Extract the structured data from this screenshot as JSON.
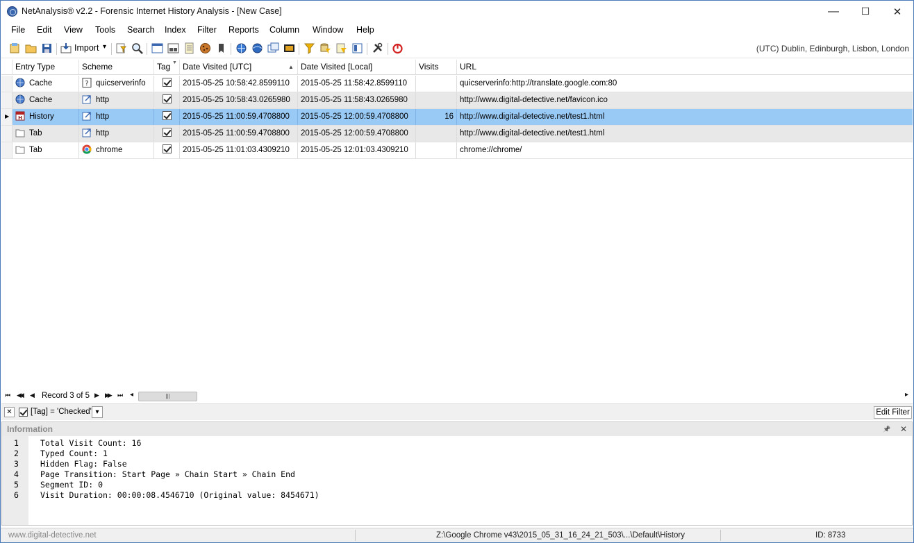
{
  "window": {
    "title": "NetAnalysis® v2.2 - Forensic Internet History Analysis - [New Case]",
    "minimize_glyph": "—",
    "maximize_glyph": "☐",
    "close_glyph": "✕"
  },
  "menu": [
    "File",
    "Edit",
    "View",
    "Tools",
    "Search",
    "Index",
    "Filter",
    "Reports",
    "Column",
    "Window",
    "Help"
  ],
  "toolbar": {
    "import_label": "Import",
    "import_arrow": "▾",
    "timezone": "(UTC) Dublin, Edinburgh, Lisbon, London"
  },
  "grid": {
    "columns": [
      "Entry Type",
      "Scheme",
      "Tag",
      "Date Visited [UTC]",
      "Date Visited [Local]",
      "Visits",
      "URL"
    ],
    "sort_glyph": "▲",
    "filter_glyph": "▼",
    "selected_marker": "▶",
    "rows": [
      {
        "entry_type": "Cache",
        "entry_icon": "cache-globe-icon",
        "scheme": "quicserverinfo",
        "scheme_icon": "question-icon",
        "utc": "2015-05-25 10:58:42.8599110",
        "local": "2015-05-25 11:58:42.8599110",
        "visits": "",
        "url": "quicserverinfo:http://translate.google.com:80"
      },
      {
        "entry_type": "Cache",
        "entry_icon": "cache-globe-icon",
        "scheme": "http",
        "scheme_icon": "link-arrow-icon",
        "utc": "2015-05-25 10:58:43.0265980",
        "local": "2015-05-25 11:58:43.0265980",
        "visits": "",
        "url": "http://www.digital-detective.net/favicon.ico"
      },
      {
        "entry_type": "History",
        "entry_icon": "history-calendar-icon",
        "scheme": "http",
        "scheme_icon": "link-arrow-icon",
        "utc": "2015-05-25 11:00:59.4708800",
        "local": "2015-05-25 12:00:59.4708800",
        "visits": "16",
        "url": "http://www.digital-detective.net/test1.html"
      },
      {
        "entry_type": "Tab",
        "entry_icon": "tab-page-icon",
        "scheme": "http",
        "scheme_icon": "link-arrow-icon",
        "utc": "2015-05-25 11:00:59.4708800",
        "local": "2015-05-25 12:00:59.4708800",
        "visits": "",
        "url": "http://www.digital-detective.net/test1.html"
      },
      {
        "entry_type": "Tab",
        "entry_icon": "tab-page-icon",
        "scheme": "chrome",
        "scheme_icon": "chrome-logo-icon",
        "utc": "2015-05-25 11:01:03.4309210",
        "local": "2015-05-25 12:01:03.4309210",
        "visits": "",
        "url": "chrome://chrome/"
      }
    ]
  },
  "navigator": {
    "first": "⏮",
    "prev_page": "◀◀",
    "prev": "◀",
    "record_text": "Record 3 of 5",
    "next": "▶",
    "next_page": "▶▶",
    "last": "⏭",
    "scroll_left": "◂",
    "scroll_right": "▸",
    "scroll_grip": "|||"
  },
  "filter": {
    "clear_glyph": "✕",
    "expression": "[Tag] = 'Checked'",
    "dropdown_glyph": "▾",
    "edit_label": "Edit Filter"
  },
  "info_panel": {
    "title": "Information",
    "pin_glyph": "📌",
    "close_glyph": "✕",
    "line_numbers": [
      "1",
      "2",
      "3",
      "4",
      "5",
      "6"
    ],
    "lines": [
      "Total Visit Count: 16",
      "Typed Count: 1",
      "Hidden Flag: False",
      "Page Transition: Start Page » Chain Start » Chain End",
      "Segment ID: 0",
      "Visit Duration: 00:00:08.4546710 (Original value: 8454671)"
    ]
  },
  "status": {
    "website": "www.digital-detective.net",
    "path": "Z:\\Google Chrome v43\\2015_05_31_16_24_21_503\\...\\Default\\History",
    "id": "ID: 8733"
  },
  "colors": {
    "selected_row": "#99c9f5",
    "alt_row": "#e8e8e8",
    "accent": "#3a67b0"
  }
}
